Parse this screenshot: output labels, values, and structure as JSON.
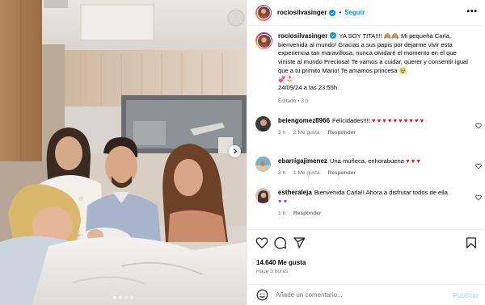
{
  "post": {
    "author": "rociosilvasinger",
    "separator": "•",
    "follow_label": "Seguir",
    "more_label": "•••",
    "caption": {
      "text": "YA SOY TITA!!!! 🙈🙈 Mi pequeña Carla, bienvenida al mundo! Gracias a sus papis por dejarme vivir esta experiencia tan maravillosa, nunca olvidaré el momento en el que viniste al mundo Preciosa! Te vamos a cuidar, querer y consentir igual que a tu primito Mario! Te amamos princesa 🥹",
      "emoji_tail": "💞👶🏻",
      "date": "24/09/24 a las 23:55h",
      "edited": "Editado",
      "time_ago": "3 h"
    }
  },
  "comments": [
    {
      "author": "belengomez8966",
      "text": "Felicidades!!!!",
      "hearts": "♥ ♥ ♥ ♥ ♥ ♥ ♥ ♥ ♥ ♥",
      "time": "3 h",
      "likes": "2 Me gusta",
      "reply": "Responder"
    },
    {
      "author": "ebarrigajimenez",
      "text": "Una muñeca, enhorabuena",
      "hearts": "♥ ♥ ♥",
      "time": "3 h",
      "likes": "1 Me gusta",
      "reply": "Responder"
    },
    {
      "author": "estheraleja",
      "text": "Bienvenida Carla!! Ahora a disfrutar todos de ella",
      "hearts": "♥ ♥",
      "time": "1 h",
      "reply": "Responder"
    }
  ],
  "stats": {
    "likes": "14.640 Me gusta",
    "time_ago": "Hace 3 horas"
  },
  "composer": {
    "placeholder": "Añade un comentario...",
    "publish_label": "Publicar"
  },
  "colors": {
    "accent": "#0095f6",
    "verified": "#0095f6",
    "muted": "#737373",
    "heart": "#e8132b"
  },
  "carousel": {
    "slide_count": 4,
    "active_index": 0
  }
}
